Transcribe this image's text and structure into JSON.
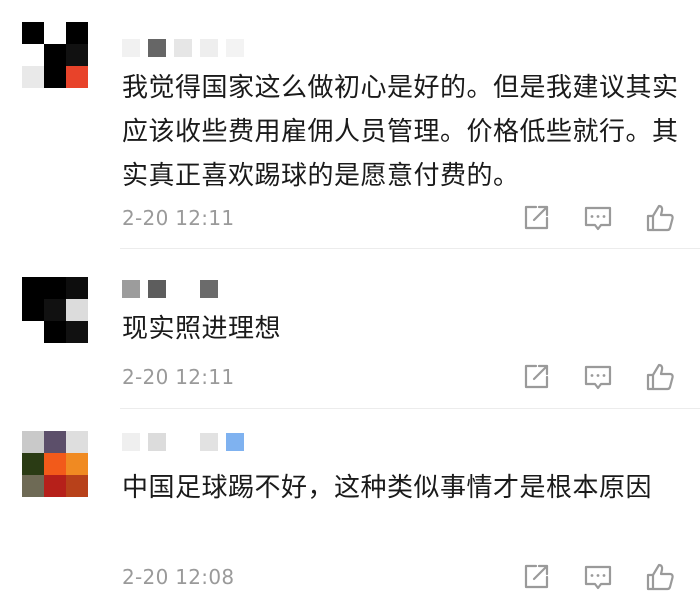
{
  "comments": [
    {
      "text": "我觉得国家这么做初心是好的。但是我建议其实应该收些费用雇佣人员管理。价格低些就行。其实真正喜欢踢球的是愿意付费的。",
      "time": "2-20 12:11",
      "avatar_colors": [
        "#000000",
        "#ffffff",
        "#000000",
        "#ffffff",
        "#000000",
        "#111111",
        "#e9e9e9",
        "#000000",
        "#e8432a"
      ],
      "username_colors": [
        "#f1f1f1",
        "#666666",
        "#e6e6e6",
        "#eeeeee",
        "#f3f3f3"
      ]
    },
    {
      "text": "现实照进理想",
      "time": "2-20 12:11",
      "avatar_colors": [
        "#000000",
        "#000000",
        "#0d0d0d",
        "#000000",
        "#111111",
        "#dcdcdc",
        "#ffffff",
        "#000000",
        "#111111"
      ],
      "username_colors": [
        "#9c9c9c",
        "#5d5d5d",
        "#ffffff",
        "#6b6b6b"
      ]
    },
    {
      "text": "中国足球踢不好，这种类似事情才是根本原因",
      "time": "2-20 12:08",
      "avatar_colors": [
        "#c9c9c9",
        "#5c4f6a",
        "#dedede",
        "#2a3b14",
        "#f25a1a",
        "#f08a22",
        "#6e6a55",
        "#b6201a",
        "#b8411a"
      ],
      "username_colors": [
        "#efefef",
        "#dcdcdc",
        "#ffffff",
        "#e2e2e2",
        "#7fb2f0"
      ]
    }
  ],
  "icons": {
    "share": "share-icon",
    "reply": "comment-icon",
    "like": "thumbs-up-icon"
  },
  "colors": {
    "text": "#1a1a1a",
    "meta": "#9a9a9a",
    "icon": "#9a9a9a",
    "divider": "#ececec"
  }
}
